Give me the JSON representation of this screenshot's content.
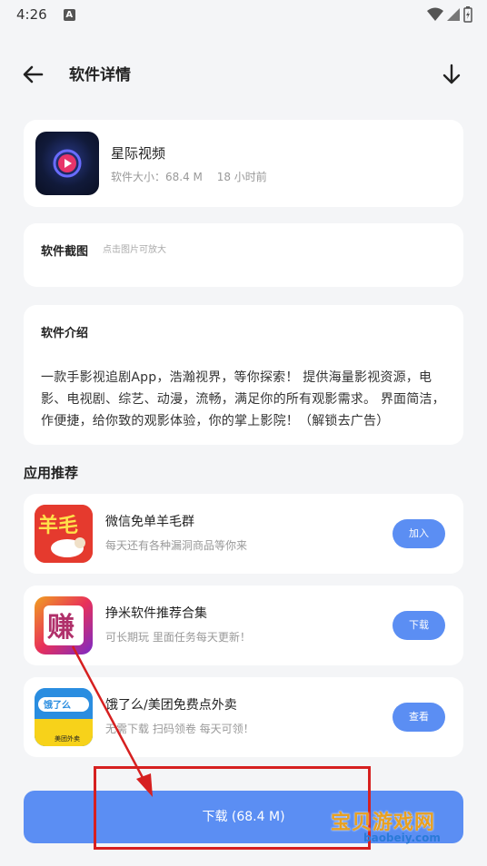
{
  "status": {
    "time": "4:26",
    "notification_letter": "A"
  },
  "header": {
    "title": "软件详情"
  },
  "app": {
    "name": "星际视频",
    "size_label": "软件大小：68.4 M",
    "updated": "18 小时前"
  },
  "screenshots": {
    "title": "软件截图",
    "hint": "点击图片可放大"
  },
  "intro": {
    "title": "软件介绍",
    "text": "一款手影视追剧App，浩瀚视界，等你探索！ 提供海量影视资源，电影、电视剧、综艺、动漫，流畅，满足你的所有观影需求。 界面简洁，作便捷，给你致的观影体验，你的掌上影院！（解锁去广告）"
  },
  "recommend": {
    "title": "应用推荐",
    "items": [
      {
        "name": "微信免单羊毛群",
        "desc": "每天还有各种漏洞商品等你来",
        "button": "加入",
        "icon": "sheep-wool-icon",
        "icon_text": "羊毛"
      },
      {
        "name": "挣米软件推荐合集",
        "desc": "可长期玩 里面任务每天更新！",
        "button": "下载",
        "icon": "earn-icon",
        "icon_text": "赚"
      },
      {
        "name": "饿了么/美团免费点外卖",
        "desc": "无需下载 扫码领卷 每天可领！",
        "button": "查看",
        "icon": "takeaway-icon",
        "icon_text": "饿了么",
        "icon_subtext": "美团外卖"
      }
    ]
  },
  "download": {
    "label": "下载 (68.4 M)"
  },
  "watermark": {
    "text": "宝贝游戏网",
    "url": "baobeiy.com"
  },
  "colors": {
    "accent": "#5b8ef3",
    "background": "#f4f5f7",
    "annotation": "#d62020"
  }
}
